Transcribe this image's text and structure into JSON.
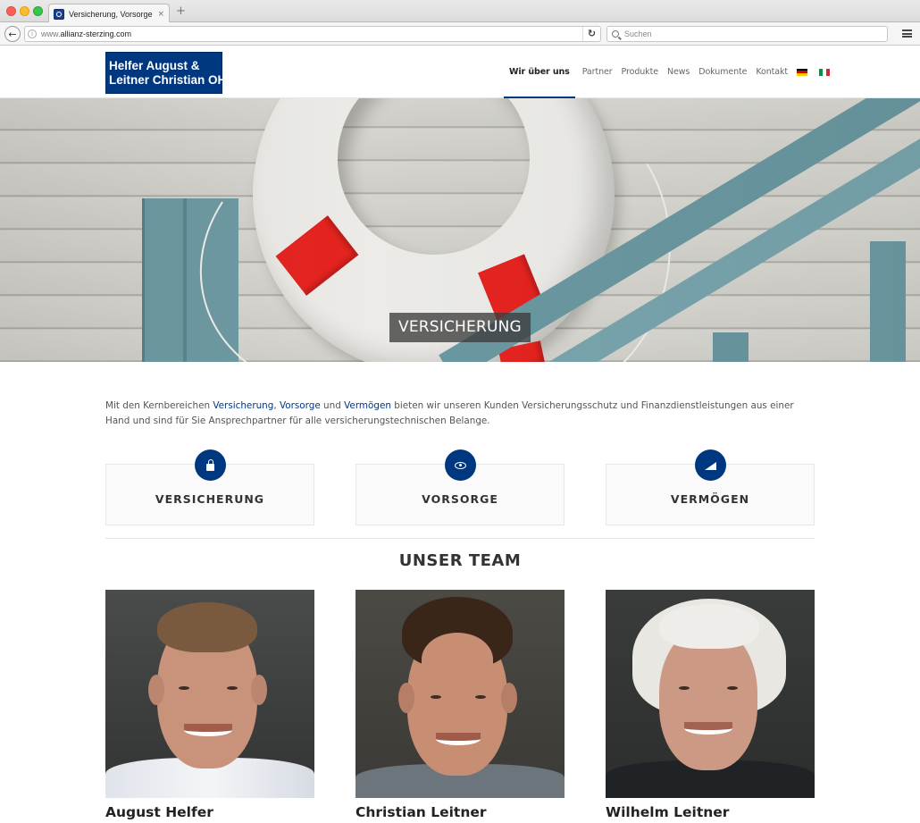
{
  "browser": {
    "tab_title": "Versicherung, Vorsorge und V",
    "tab_close": "×",
    "new_tab": "+",
    "url_prefix": "www.",
    "url_domain": "allianz-sterzing.com",
    "search_placeholder": "Suchen",
    "back_icon": "←",
    "reload_icon": "↻"
  },
  "header": {
    "logo_line1": "Helfer August &",
    "logo_line2": "Leitner Christian OHG",
    "nav": [
      "Wir über uns",
      "Partner",
      "Produkte",
      "News",
      "Dokumente",
      "Kontakt"
    ],
    "active_nav": "Wir über uns",
    "languages": [
      "de-flag-icon",
      "it-flag-icon"
    ]
  },
  "hero": {
    "label": "VERSICHERUNG"
  },
  "intro": {
    "text_1": "Mit den Kernbereichen ",
    "link_1": "Versicherung",
    "text_2": ", ",
    "link_2": "Vorsorge",
    "text_3": " und ",
    "link_3": "Vermögen",
    "text_4": " bieten wir unseren Kunden Versicherungsschutz und Finanzdienstleistungen aus einer Hand und sind für Sie Ansprechpartner für alle versicherungstechnischen Belange."
  },
  "cards": [
    {
      "title": "VERSICHERUNG",
      "icon": "lock-icon"
    },
    {
      "title": "VORSORGE",
      "icon": "eye-icon"
    },
    {
      "title": "VERMÖGEN",
      "icon": "area-chart-icon"
    }
  ],
  "team": {
    "heading": "UNSER TEAM",
    "members": [
      {
        "name": "August Helfer"
      },
      {
        "name": "Christian Leitner"
      },
      {
        "name": "Wilhelm Leitner"
      }
    ]
  },
  "colors": {
    "brand": "#003781",
    "accent_red": "#e6231f"
  }
}
